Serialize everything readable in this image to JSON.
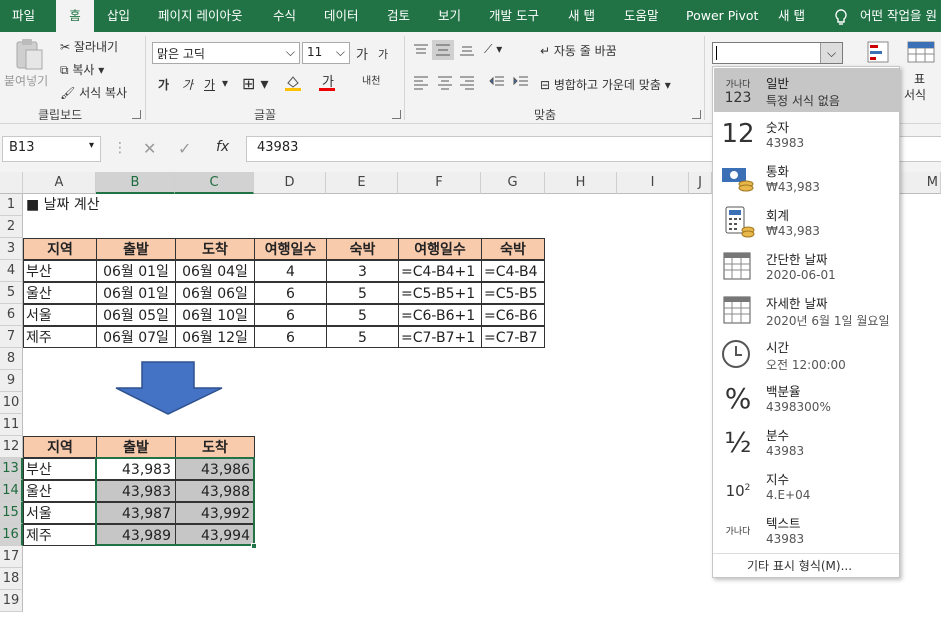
{
  "tabs": [
    "파일",
    "홈",
    "삽입",
    "페이지 레이아웃",
    "수식",
    "데이터",
    "검토",
    "보기",
    "개발 도구",
    "새 탭",
    "도움말",
    "Power Pivot",
    "새 탭"
  ],
  "tell_me": "어떤 작업을 원",
  "ribbon": {
    "clipboard": {
      "paste": "붙여넣기",
      "cut": "잘라내기",
      "copy": "복사",
      "format_painter": "서식 복사",
      "label": "클립보드"
    },
    "font": {
      "name": "맑은 고딕",
      "size": "11",
      "grow": "가",
      "shrink": "가",
      "bold": "가",
      "italic": "가",
      "underline": "가",
      "label": "글꼴",
      "phonetic": "내천"
    },
    "align": {
      "wrap": "자동 줄 바꿈",
      "merge": "병합하고 가운데 맞춤",
      "label": "맞춤"
    },
    "styles": {
      "table": "표",
      "format": "서식"
    },
    "number_format_value": ""
  },
  "namebox": "B13",
  "fx": "fx",
  "formula": "43983",
  "columns": [
    "A",
    "B",
    "C",
    "D",
    "E",
    "F",
    "G",
    "H",
    "I",
    "J",
    "M"
  ],
  "rows": [
    "1",
    "2",
    "3",
    "4",
    "5",
    "6",
    "7",
    "8",
    "9",
    "10",
    "11",
    "12",
    "13",
    "14",
    "15",
    "16",
    "17",
    "18",
    "19"
  ],
  "title_cell": "■ 날짜 계산",
  "table1": {
    "headers": [
      "지역",
      "출발",
      "도착",
      "여행일수",
      "숙박",
      "여행일수",
      "숙박"
    ],
    "rows": [
      [
        "부산",
        "06월 01일",
        "06월 04일",
        "4",
        "3",
        "=C4-B4+1",
        "=C4-B4"
      ],
      [
        "울산",
        "06월 01일",
        "06월 06일",
        "6",
        "5",
        "=C5-B5+1",
        "=C5-B5"
      ],
      [
        "서울",
        "06월 05일",
        "06월 10일",
        "6",
        "5",
        "=C6-B6+1",
        "=C6-B6"
      ],
      [
        "제주",
        "06월 07일",
        "06월 12일",
        "6",
        "5",
        "=C7-B7+1",
        "=C7-B7"
      ]
    ]
  },
  "table2": {
    "headers": [
      "지역",
      "출발",
      "도착"
    ],
    "rows": [
      [
        "부산",
        "43,983",
        "43,986"
      ],
      [
        "울산",
        "43,983",
        "43,988"
      ],
      [
        "서울",
        "43,987",
        "43,992"
      ],
      [
        "제주",
        "43,989",
        "43,994"
      ]
    ]
  },
  "arrow_color": "#4472c4",
  "number_formats": [
    {
      "name": "일반",
      "example": "특정 서식 없음",
      "icon": "general-icon",
      "icon_text": "가나다",
      "icon_sub": "123"
    },
    {
      "name": "숫자",
      "example": "43983",
      "icon": "number-icon",
      "icon_text": "12"
    },
    {
      "name": "통화",
      "example": "₩43,983",
      "icon": "currency-icon"
    },
    {
      "name": "회계",
      "example": " ₩43,983",
      "icon": "accounting-icon"
    },
    {
      "name": "간단한 날짜",
      "example": "2020-06-01",
      "icon": "short-date-icon"
    },
    {
      "name": "자세한 날짜",
      "example": "2020년 6월 1일 월요일",
      "icon": "long-date-icon"
    },
    {
      "name": "시간",
      "example": "오전 12:00:00",
      "icon": "clock-icon"
    },
    {
      "name": "백분율",
      "example": "4398300%",
      "icon": "percent-icon",
      "icon_text": "%"
    },
    {
      "name": "분수",
      "example": "43983",
      "icon": "fraction-icon",
      "icon_text": "½"
    },
    {
      "name": "지수",
      "example": "4.E+04",
      "icon": "scientific-icon",
      "icon_text": "10"
    },
    {
      "name": "텍스트",
      "example": "43983",
      "icon": "text-icon",
      "icon_text": "가나다"
    }
  ],
  "more_formats": "기타 표시 형식(M)..."
}
